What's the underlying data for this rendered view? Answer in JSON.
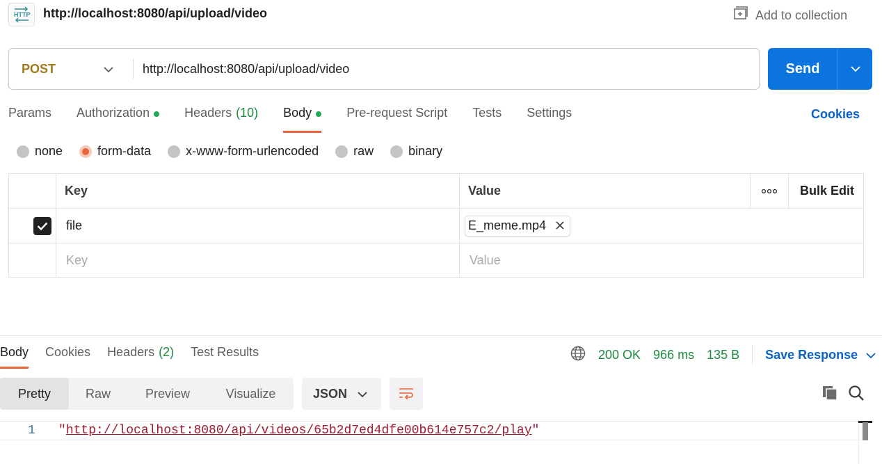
{
  "request": {
    "icon_text": "HTTP",
    "title": "http://localhost:8080/api/upload/video",
    "add_to_collection": "Add to collection",
    "method": "POST",
    "url": "http://localhost:8080/api/upload/video",
    "send_label": "Send"
  },
  "request_tabs": {
    "params": "Params",
    "authorization": "Authorization",
    "headers": "Headers",
    "headers_count": "(10)",
    "body": "Body",
    "pre_request": "Pre-request Script",
    "tests": "Tests",
    "settings": "Settings",
    "cookies": "Cookies"
  },
  "body_types": {
    "selected": "form-data",
    "none": "none",
    "form_data": "form-data",
    "urlencoded": "x-www-form-urlencoded",
    "raw": "raw",
    "binary": "binary"
  },
  "form_table": {
    "header_key": "Key",
    "header_value": "Value",
    "bulk_edit": "Bulk Edit",
    "rows": [
      {
        "checked": true,
        "key": "file",
        "value_file": "E_meme.mp4"
      }
    ],
    "placeholder_key": "Key",
    "placeholder_value": "Value"
  },
  "response_tabs": {
    "body": "Body",
    "cookies": "Cookies",
    "headers": "Headers",
    "headers_count": "(2)",
    "test_results": "Test Results"
  },
  "response_meta": {
    "status": "200 OK",
    "time": "966 ms",
    "size": "135 B",
    "save_response": "Save Response"
  },
  "format_bar": {
    "pretty": "Pretty",
    "raw": "Raw",
    "preview": "Preview",
    "visualize": "Visualize",
    "language": "JSON"
  },
  "response_body": {
    "line_number": "1",
    "quote_open": "\"",
    "link": "http://localhost:8080/api/videos/65b2d7ed4dfe00b614e757c2/play",
    "quote_close": "\""
  },
  "colors": {
    "send": "#0b74de",
    "method": "#a3791b",
    "active_tab": "#e8633a",
    "status_ok": "#1d8a3f",
    "link": "#0b62c4"
  }
}
